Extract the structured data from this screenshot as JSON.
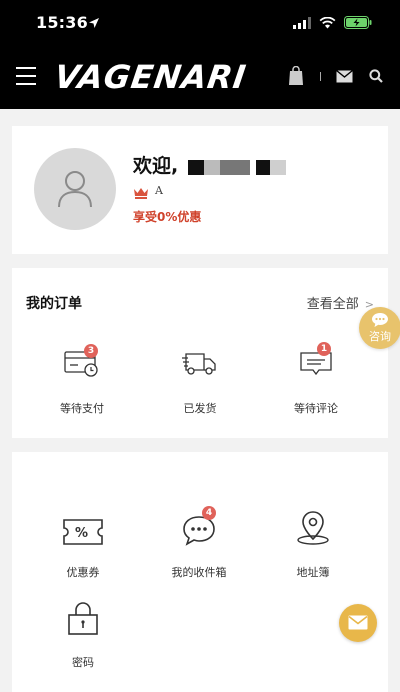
{
  "status_bar": {
    "time": "15:36"
  },
  "nav": {
    "logo_text": "VAGENARI"
  },
  "profile": {
    "welcome": "欢迎,",
    "level_letter": "A",
    "benefit": "享受0%优惠"
  },
  "orders": {
    "title": "我的订单",
    "view_all": "查看全部",
    "items": [
      {
        "label": "等待支付",
        "badge": "3",
        "icon": "wallet-clock-icon"
      },
      {
        "label": "已发货",
        "badge": "",
        "icon": "truck-icon"
      },
      {
        "label": "等待评论",
        "badge": "1",
        "icon": "comment-icon"
      }
    ]
  },
  "services": {
    "items": [
      {
        "label": "优惠券",
        "badge": "",
        "icon": "coupon-icon"
      },
      {
        "label": "我的收件箱",
        "badge": "4",
        "icon": "chat-bubble-icon"
      },
      {
        "label": "地址簿",
        "badge": "",
        "icon": "location-pin-icon"
      },
      {
        "label": "密码",
        "badge": "",
        "icon": "lock-icon"
      }
    ]
  },
  "consult": {
    "label": "咨询"
  },
  "colors": {
    "accent_red": "#d0422b",
    "badge": "#e0625a",
    "gold": "#e8c36c",
    "nav_bg": "#000000"
  }
}
